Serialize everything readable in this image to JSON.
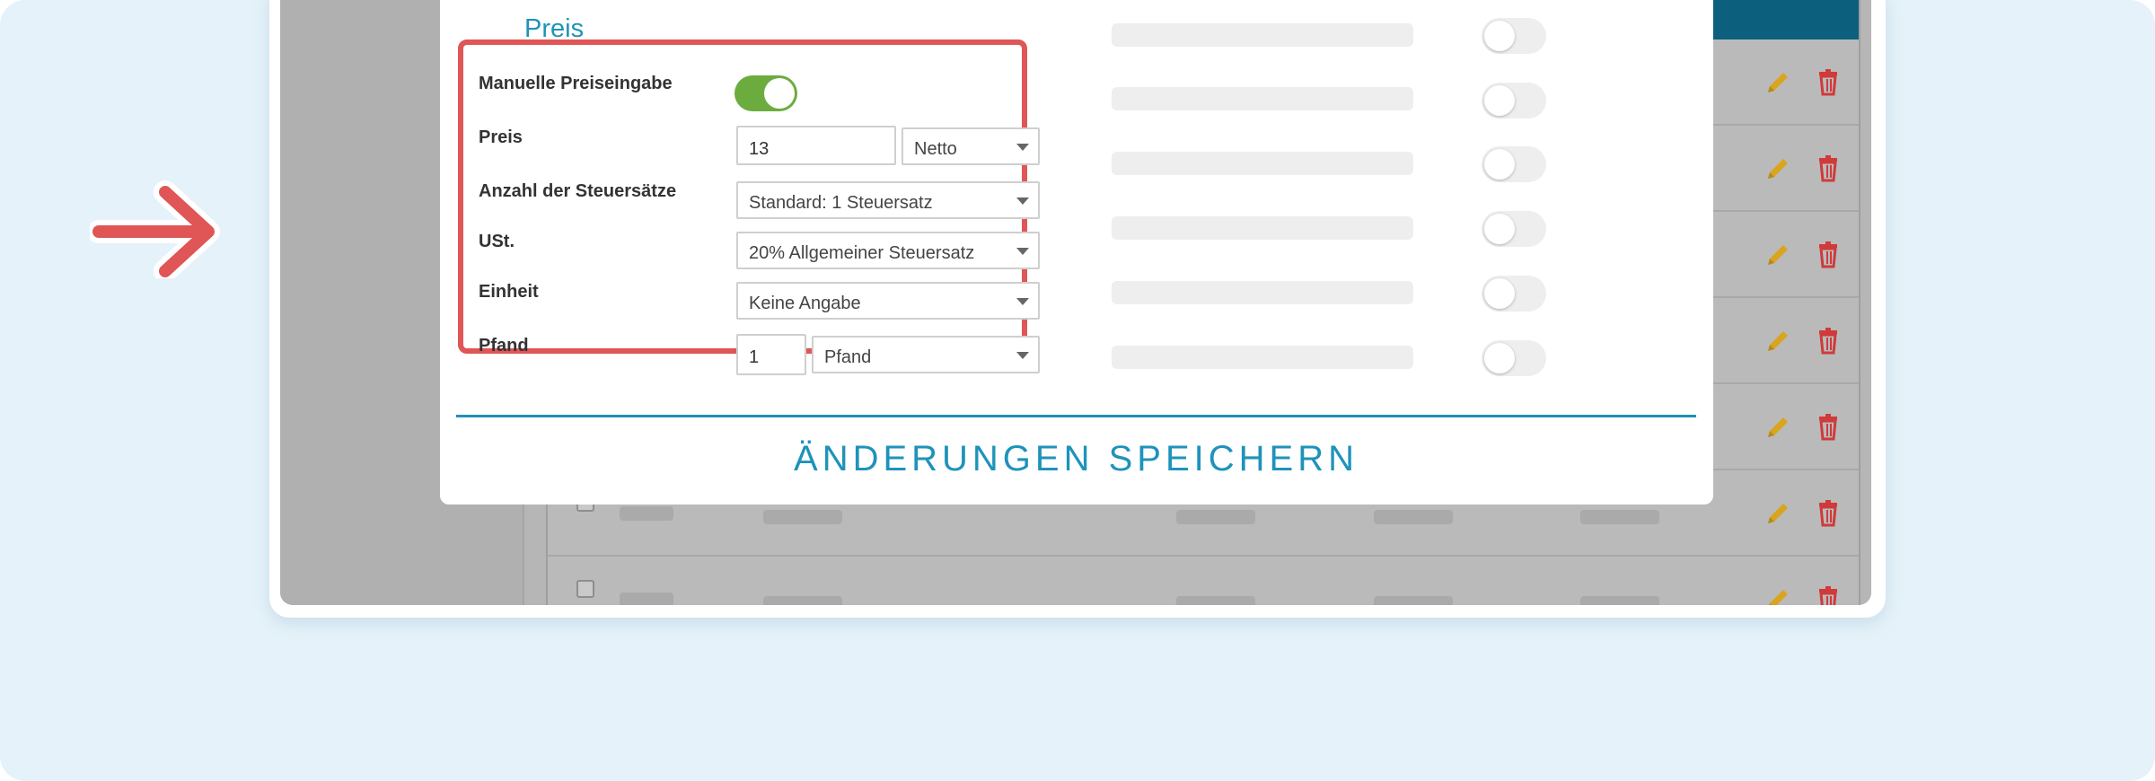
{
  "price_section": {
    "title": "Preis",
    "fields": {
      "manual_price": {
        "label": "Manuelle Preiseingabe",
        "enabled": true
      },
      "price": {
        "label": "Preis",
        "value": "13",
        "type_selected": "Netto"
      },
      "tax_count": {
        "label": "Anzahl der Steuersätze",
        "selected": "Standard: 1 Steuersatz"
      },
      "vat": {
        "label": "USt.",
        "selected": "20% Allgemeiner Steuersatz"
      },
      "unit": {
        "label": "Einheit",
        "selected": "Keine Angabe"
      },
      "deposit": {
        "label": "Pfand",
        "value": "1",
        "selected": "Pfand"
      }
    }
  },
  "save_button": {
    "label": "ÄNDERUNGEN SPEICHERN"
  },
  "colors": {
    "accent": "#1e93ba",
    "toggle_on": "#6cac3f",
    "highlight": "#e05555",
    "edit_icon": "#d9a520",
    "delete_icon": "#d03a3a"
  }
}
